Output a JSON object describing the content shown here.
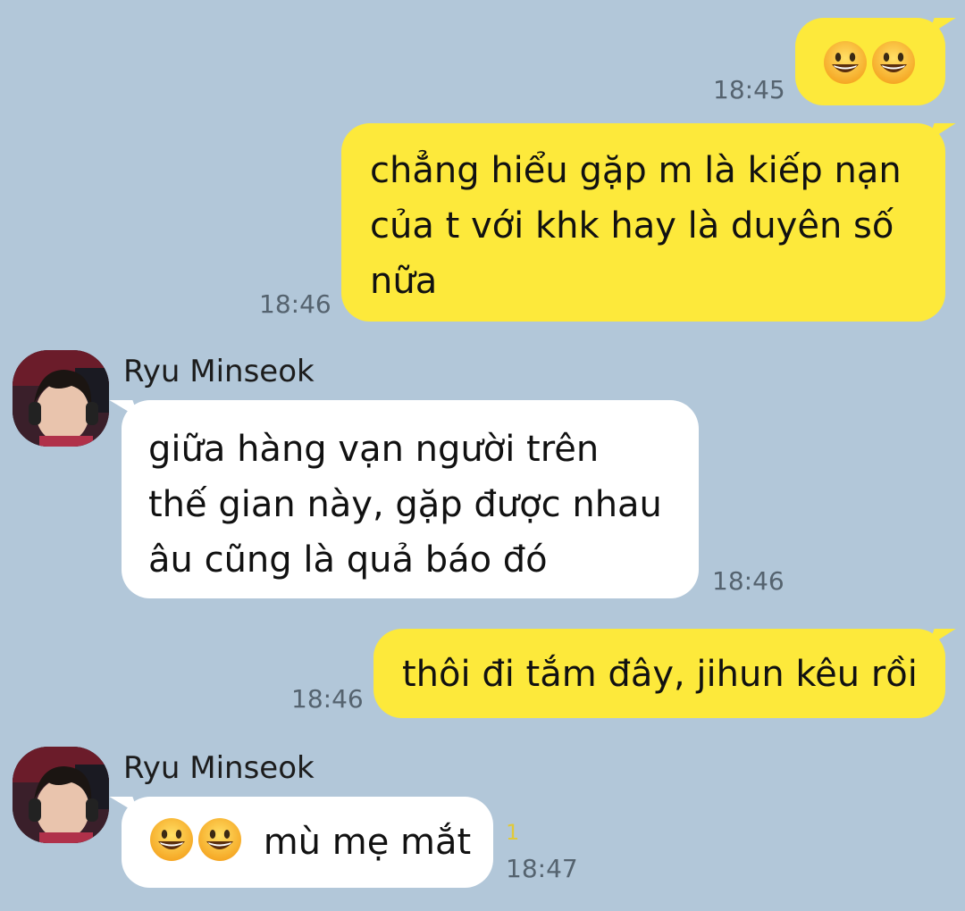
{
  "messages": [
    {
      "direction": "outgoing",
      "emojis": [
        "grinning-face",
        "grinning-face"
      ],
      "text_lines": [],
      "time": "18:45"
    },
    {
      "direction": "outgoing",
      "text_lines": [
        "chẳng hiểu gặp m là kiếp nạn",
        "của t với khk hay là duyên số",
        "nữa"
      ],
      "time": "18:46"
    },
    {
      "direction": "incoming",
      "sender": "Ryu Minseok",
      "text_lines": [
        "giữa hàng vạn người trên",
        "thế gian này, gặp được nhau",
        "âu cũng là quả báo đó"
      ],
      "time": "18:46"
    },
    {
      "direction": "outgoing",
      "text_lines": [
        "thôi đi tắm đây, jihun kêu rồi"
      ],
      "time": "18:46"
    },
    {
      "direction": "incoming",
      "sender": "Ryu Minseok",
      "emojis": [
        "grinning-face",
        "grinning-face"
      ],
      "text_lines": [
        "mù mẹ mắt"
      ],
      "time": "18:47",
      "unread_count": "1"
    }
  ],
  "colors": {
    "background": "#b2c7d9",
    "outgoing_bubble": "#fde93b",
    "incoming_bubble": "#ffffff",
    "timestamp": "#55636f",
    "unread": "#e0c93a"
  }
}
